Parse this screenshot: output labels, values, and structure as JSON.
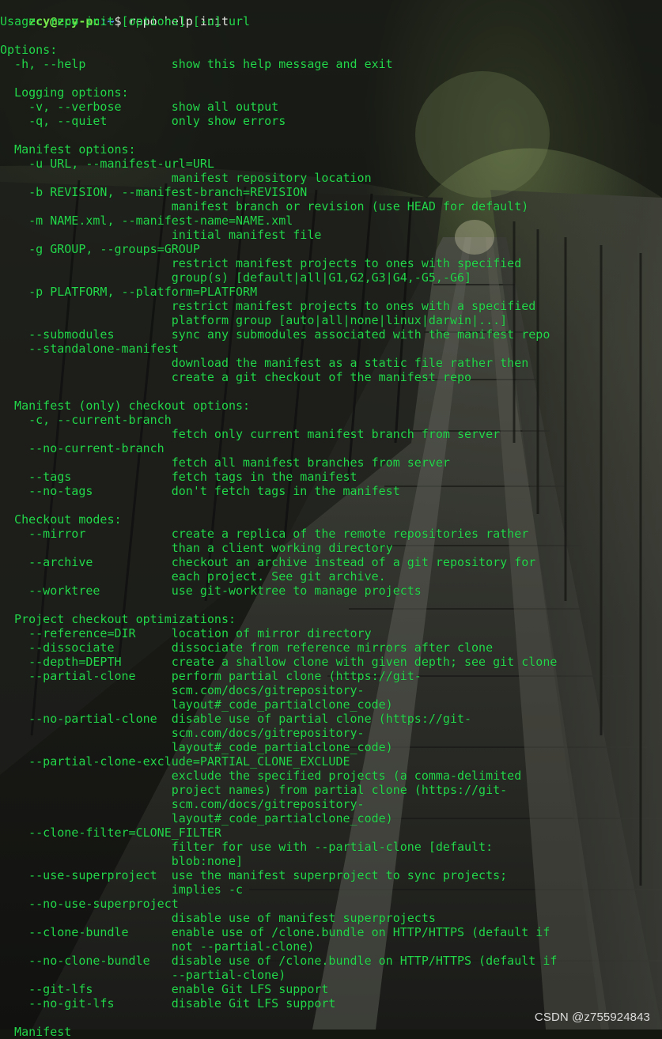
{
  "prompt": {
    "user_host": "zcy@zcy-pc",
    "path": ":~",
    "sigil": "$ ",
    "command": "repo help init"
  },
  "terminal_lines": [
    "Usage: repo init [options] [-u] url",
    "",
    "Options:",
    "  -h, --help            show this help message and exit",
    "",
    "  Logging options:",
    "    -v, --verbose       show all output",
    "    -q, --quiet         only show errors",
    "",
    "  Manifest options:",
    "    -u URL, --manifest-url=URL",
    "                        manifest repository location",
    "    -b REVISION, --manifest-branch=REVISION",
    "                        manifest branch or revision (use HEAD for default)",
    "    -m NAME.xml, --manifest-name=NAME.xml",
    "                        initial manifest file",
    "    -g GROUP, --groups=GROUP",
    "                        restrict manifest projects to ones with specified",
    "                        group(s) [default|all|G1,G2,G3|G4,-G5,-G6]",
    "    -p PLATFORM, --platform=PLATFORM",
    "                        restrict manifest projects to ones with a specified",
    "                        platform group [auto|all|none|linux|darwin|...]",
    "    --submodules        sync any submodules associated with the manifest repo",
    "    --standalone-manifest",
    "                        download the manifest as a static file rather then",
    "                        create a git checkout of the manifest repo",
    "",
    "  Manifest (only) checkout options:",
    "    -c, --current-branch",
    "                        fetch only current manifest branch from server",
    "    --no-current-branch",
    "                        fetch all manifest branches from server",
    "    --tags              fetch tags in the manifest",
    "    --no-tags           don't fetch tags in the manifest",
    "",
    "  Checkout modes:",
    "    --mirror            create a replica of the remote repositories rather",
    "                        than a client working directory",
    "    --archive           checkout an archive instead of a git repository for",
    "                        each project. See git archive.",
    "    --worktree          use git-worktree to manage projects",
    "",
    "  Project checkout optimizations:",
    "    --reference=DIR     location of mirror directory",
    "    --dissociate        dissociate from reference mirrors after clone",
    "    --depth=DEPTH       create a shallow clone with given depth; see git clone",
    "    --partial-clone     perform partial clone (https://git-",
    "                        scm.com/docs/gitrepository-",
    "                        layout#_code_partialclone_code)",
    "    --no-partial-clone  disable use of partial clone (https://git-",
    "                        scm.com/docs/gitrepository-",
    "                        layout#_code_partialclone_code)",
    "    --partial-clone-exclude=PARTIAL_CLONE_EXCLUDE",
    "                        exclude the specified projects (a comma-delimited",
    "                        project names) from partial clone (https://git-",
    "                        scm.com/docs/gitrepository-",
    "                        layout#_code_partialclone_code)",
    "    --clone-filter=CLONE_FILTER",
    "                        filter for use with --partial-clone [default:",
    "                        blob:none]",
    "    --use-superproject  use the manifest superproject to sync projects;",
    "                        implies -c",
    "    --no-use-superproject",
    "                        disable use of manifest superprojects",
    "    --clone-bundle      enable use of /clone.bundle on HTTP/HTTPS (default if",
    "                        not --partial-clone)",
    "    --no-clone-bundle   disable use of /clone.bundle on HTTP/HTTPS (default if",
    "                        --partial-clone)",
    "    --git-lfs           enable Git LFS support",
    "    --no-git-lfs        disable Git LFS support",
    "",
    "  Manifest"
  ],
  "watermark": "CSDN @z755924843"
}
